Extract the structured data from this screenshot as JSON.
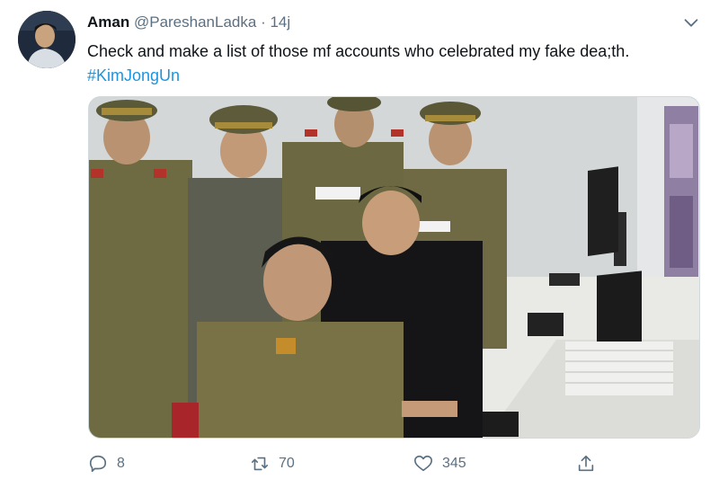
{
  "tweet": {
    "display_name": "Aman",
    "handle": "@PareshanLadka",
    "separator": "·",
    "time": "14j",
    "text": "Check and make a list of those mf accounts who celebrated my fake dea;th.",
    "hashtag": "#KimJongUn"
  },
  "actions": {
    "reply_count": "8",
    "retweet_count": "70",
    "like_count": "345"
  },
  "icons": {
    "menu": "chevron-down-icon",
    "reply": "reply-icon",
    "retweet": "retweet-icon",
    "like": "heart-icon",
    "share": "share-icon"
  },
  "colors": {
    "hashtag": "#1b95e0",
    "secondary_text": "#5b7083",
    "uniform_olive": "#6e6a42"
  }
}
